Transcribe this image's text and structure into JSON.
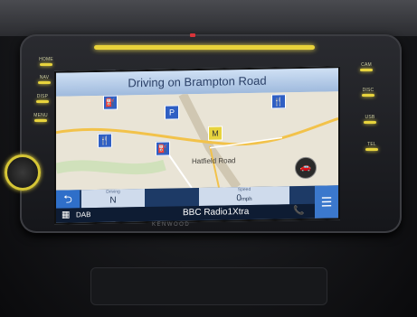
{
  "navigation": {
    "banner": "Driving on Brampton Road",
    "place_label": "Hatfield Road",
    "heading_label": "Driving",
    "heading_value": "N",
    "speed_label": "Speed",
    "speed_value": "0",
    "speed_unit": "mph"
  },
  "audio": {
    "source": "DAB",
    "station": "BBC Radio1Xtra"
  },
  "left_buttons": [
    "HOME",
    "NAV",
    "DISP",
    "MENU"
  ],
  "right_buttons": [
    "CAM",
    "DISC",
    "USB",
    "TEL"
  ],
  "brand": "KENWOOD",
  "colors": {
    "accent_led": "#e8d23a",
    "map_road": "#f2c24a",
    "bar_blue": "#1d3a66"
  }
}
